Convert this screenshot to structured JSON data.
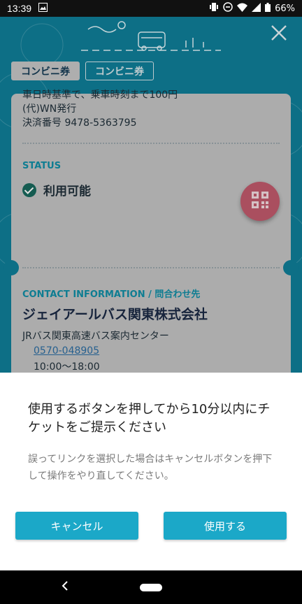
{
  "status_bar": {
    "time": "13:39",
    "battery": "66%"
  },
  "header": {
    "close_icon": "close-icon"
  },
  "tabs": [
    {
      "label": "コンビニ券",
      "active": true
    },
    {
      "label": "コンビニ券",
      "active": false
    }
  ],
  "ticket": {
    "lines": [
      "車日時基準で、乗車時刻まで100円",
      "(代)WN発行",
      "決済番号 9478-5363795"
    ],
    "status_label": "STATUS",
    "status_value": "利用可能"
  },
  "contact": {
    "label": "CONTACT INFORMATION / 問合わせ先",
    "company": "ジェイアールバス関東株式会社",
    "center": "JRバス関東高速バス案内センター",
    "phone": "0570-048905",
    "hours": "10:00〜18:00"
  },
  "dialog": {
    "title": "使用するボタンを押してから10分以内にチケットをご提示ください",
    "body": "誤ってリンクを選択した場合はキャンセルボタンを押下して操作をやり直してください。",
    "cancel_label": "キャンセル",
    "use_label": "使用する"
  },
  "colors": {
    "teal": "#0f7f99",
    "button": "#1ba8c8",
    "fab": "#c25a6d"
  }
}
